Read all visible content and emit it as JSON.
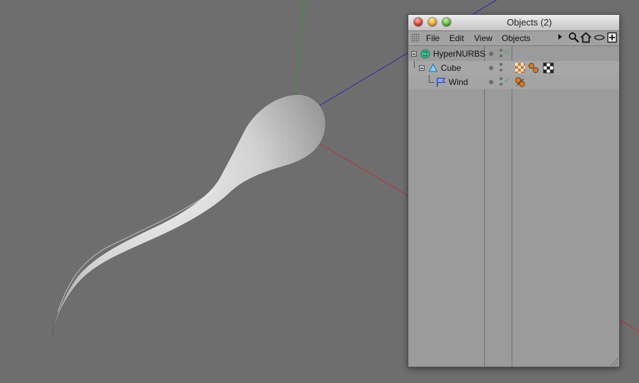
{
  "window": {
    "title": "Objects (2)"
  },
  "menu": {
    "file": "File",
    "edit": "Edit",
    "view": "View",
    "objects": "Objects"
  },
  "toolbar_icons": [
    "search-icon",
    "home-icon",
    "eye-icon",
    "new-window-icon"
  ],
  "objects": [
    {
      "name": "HyperNURBS",
      "icon": "hypernurbs-icon",
      "checked": true,
      "tags": []
    },
    {
      "name": "Cube",
      "icon": "cube-icon",
      "checked": false,
      "tags": [
        "texture-tag",
        "spheres-tag",
        "checker-tag"
      ]
    },
    {
      "name": "Wind",
      "icon": "wind-icon",
      "checked": true,
      "tags": [
        "dynamics-tag"
      ]
    }
  ],
  "colors": {
    "viewport_bg": "#6e6e6e",
    "axis_y": "#2e9e2e",
    "axis_z": "#2a2aa8",
    "axis_x": "#b83232",
    "check": "#2fb84b"
  }
}
